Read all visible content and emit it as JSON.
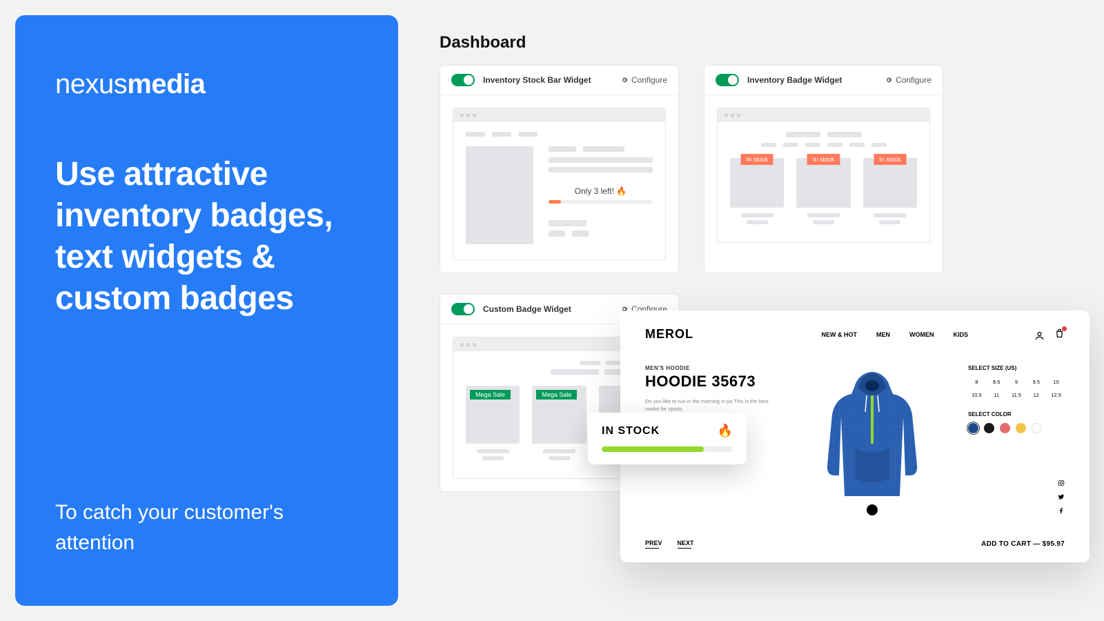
{
  "promo": {
    "brand_light": "nexus",
    "brand_bold": "media",
    "headline": "Use attractive inventory badges, text widgets & custom badges",
    "subtext": "To catch your customer's attention"
  },
  "dashboard": {
    "title": "Dashboard",
    "configure_label": "Configure",
    "widgets": {
      "stock_bar": {
        "name": "Inventory Stock Bar Widget",
        "stock_text": "Only 3 left! 🔥"
      },
      "badge": {
        "name": "Inventory Badge Widget",
        "badge_text": "In stock"
      },
      "custom": {
        "name": "Custom Badge Widget",
        "badge_text": "Mega Sale"
      }
    }
  },
  "stock_popup": {
    "text": "IN STOCK",
    "fire": "🔥"
  },
  "product": {
    "logo": "MEROL",
    "nav": [
      "NEW & HOT",
      "MEN",
      "WOMEN",
      "KIDS"
    ],
    "category": "MEN'S HOODIE",
    "title": "HOODIE 35673",
    "description": "Do you like to run in the morning in pa This is the best model for sports.",
    "size_label": "SELECT SIZE (US)",
    "sizes": [
      "8",
      "8.5",
      "9",
      "9.5",
      "10",
      "10.5",
      "11",
      "11.5",
      "12",
      "12.5"
    ],
    "color_label": "SELECT COLOR",
    "colors": [
      "#1b4a8a",
      "#1a1a1a",
      "#e56b6f",
      "#f2c44b",
      "#ffffff"
    ],
    "prev": "PREV",
    "next": "NEXT",
    "add_to_cart": "ADD TO CART — $95.97"
  }
}
